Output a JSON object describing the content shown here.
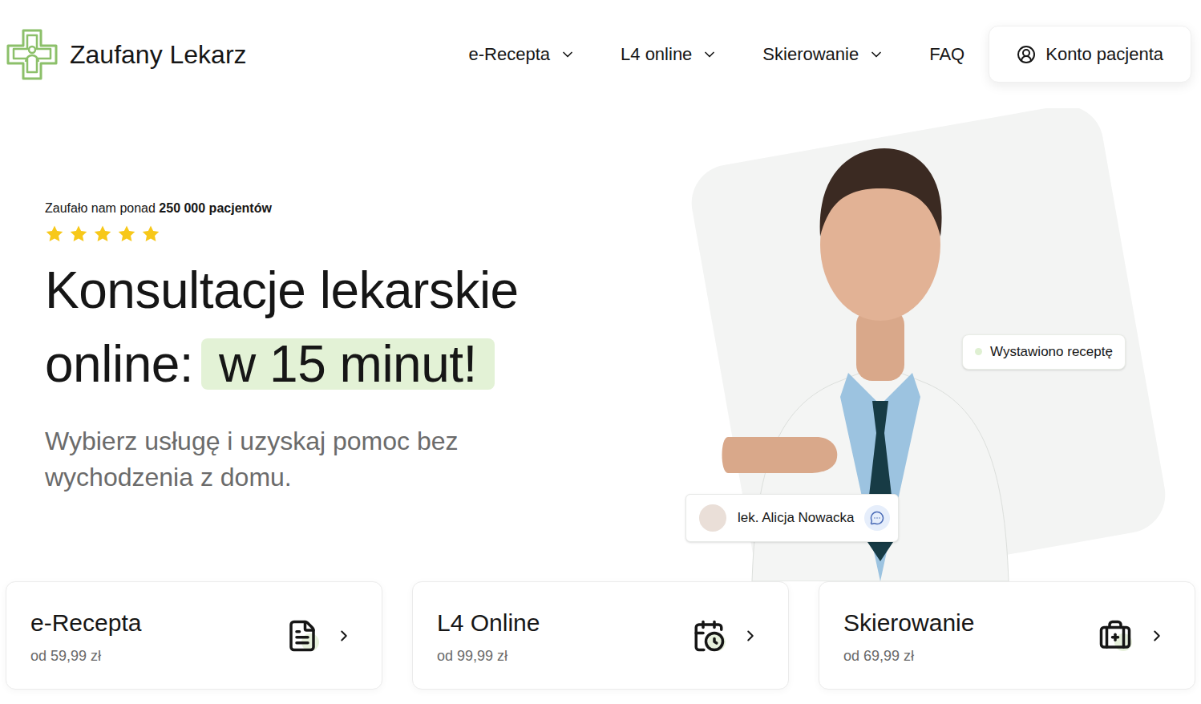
{
  "brand": {
    "name": "Zaufany Lekarz"
  },
  "nav": [
    {
      "label": "e-Recepta",
      "dropdown": true
    },
    {
      "label": "L4 online",
      "dropdown": true
    },
    {
      "label": "Skierowanie",
      "dropdown": true
    },
    {
      "label": "FAQ",
      "dropdown": false
    }
  ],
  "account_button": "Konto pacjenta",
  "hero": {
    "trust_prefix": "Zaufało nam ponad ",
    "trust_count": "250 000 pacjentów",
    "stars": 5,
    "title_line1": "Konsultacje lekarskie",
    "title_line2": "online:",
    "highlight": "w 15 minut!",
    "subtitle": "Wybierz usługę i uzyskaj pomoc bez wychodzenia z domu."
  },
  "badges": {
    "status": "Wystawiono receptę",
    "doctor": "lek. Alicja Nowacka"
  },
  "services": [
    {
      "title": "e-Recepta",
      "price": "od 59,99 zł",
      "kind": "prescription"
    },
    {
      "title": "L4 Online",
      "price": "od 99,99 zł",
      "kind": "sickleave"
    },
    {
      "title": "Skierowanie",
      "price": "od 69,99 zł",
      "kind": "referral"
    }
  ]
}
